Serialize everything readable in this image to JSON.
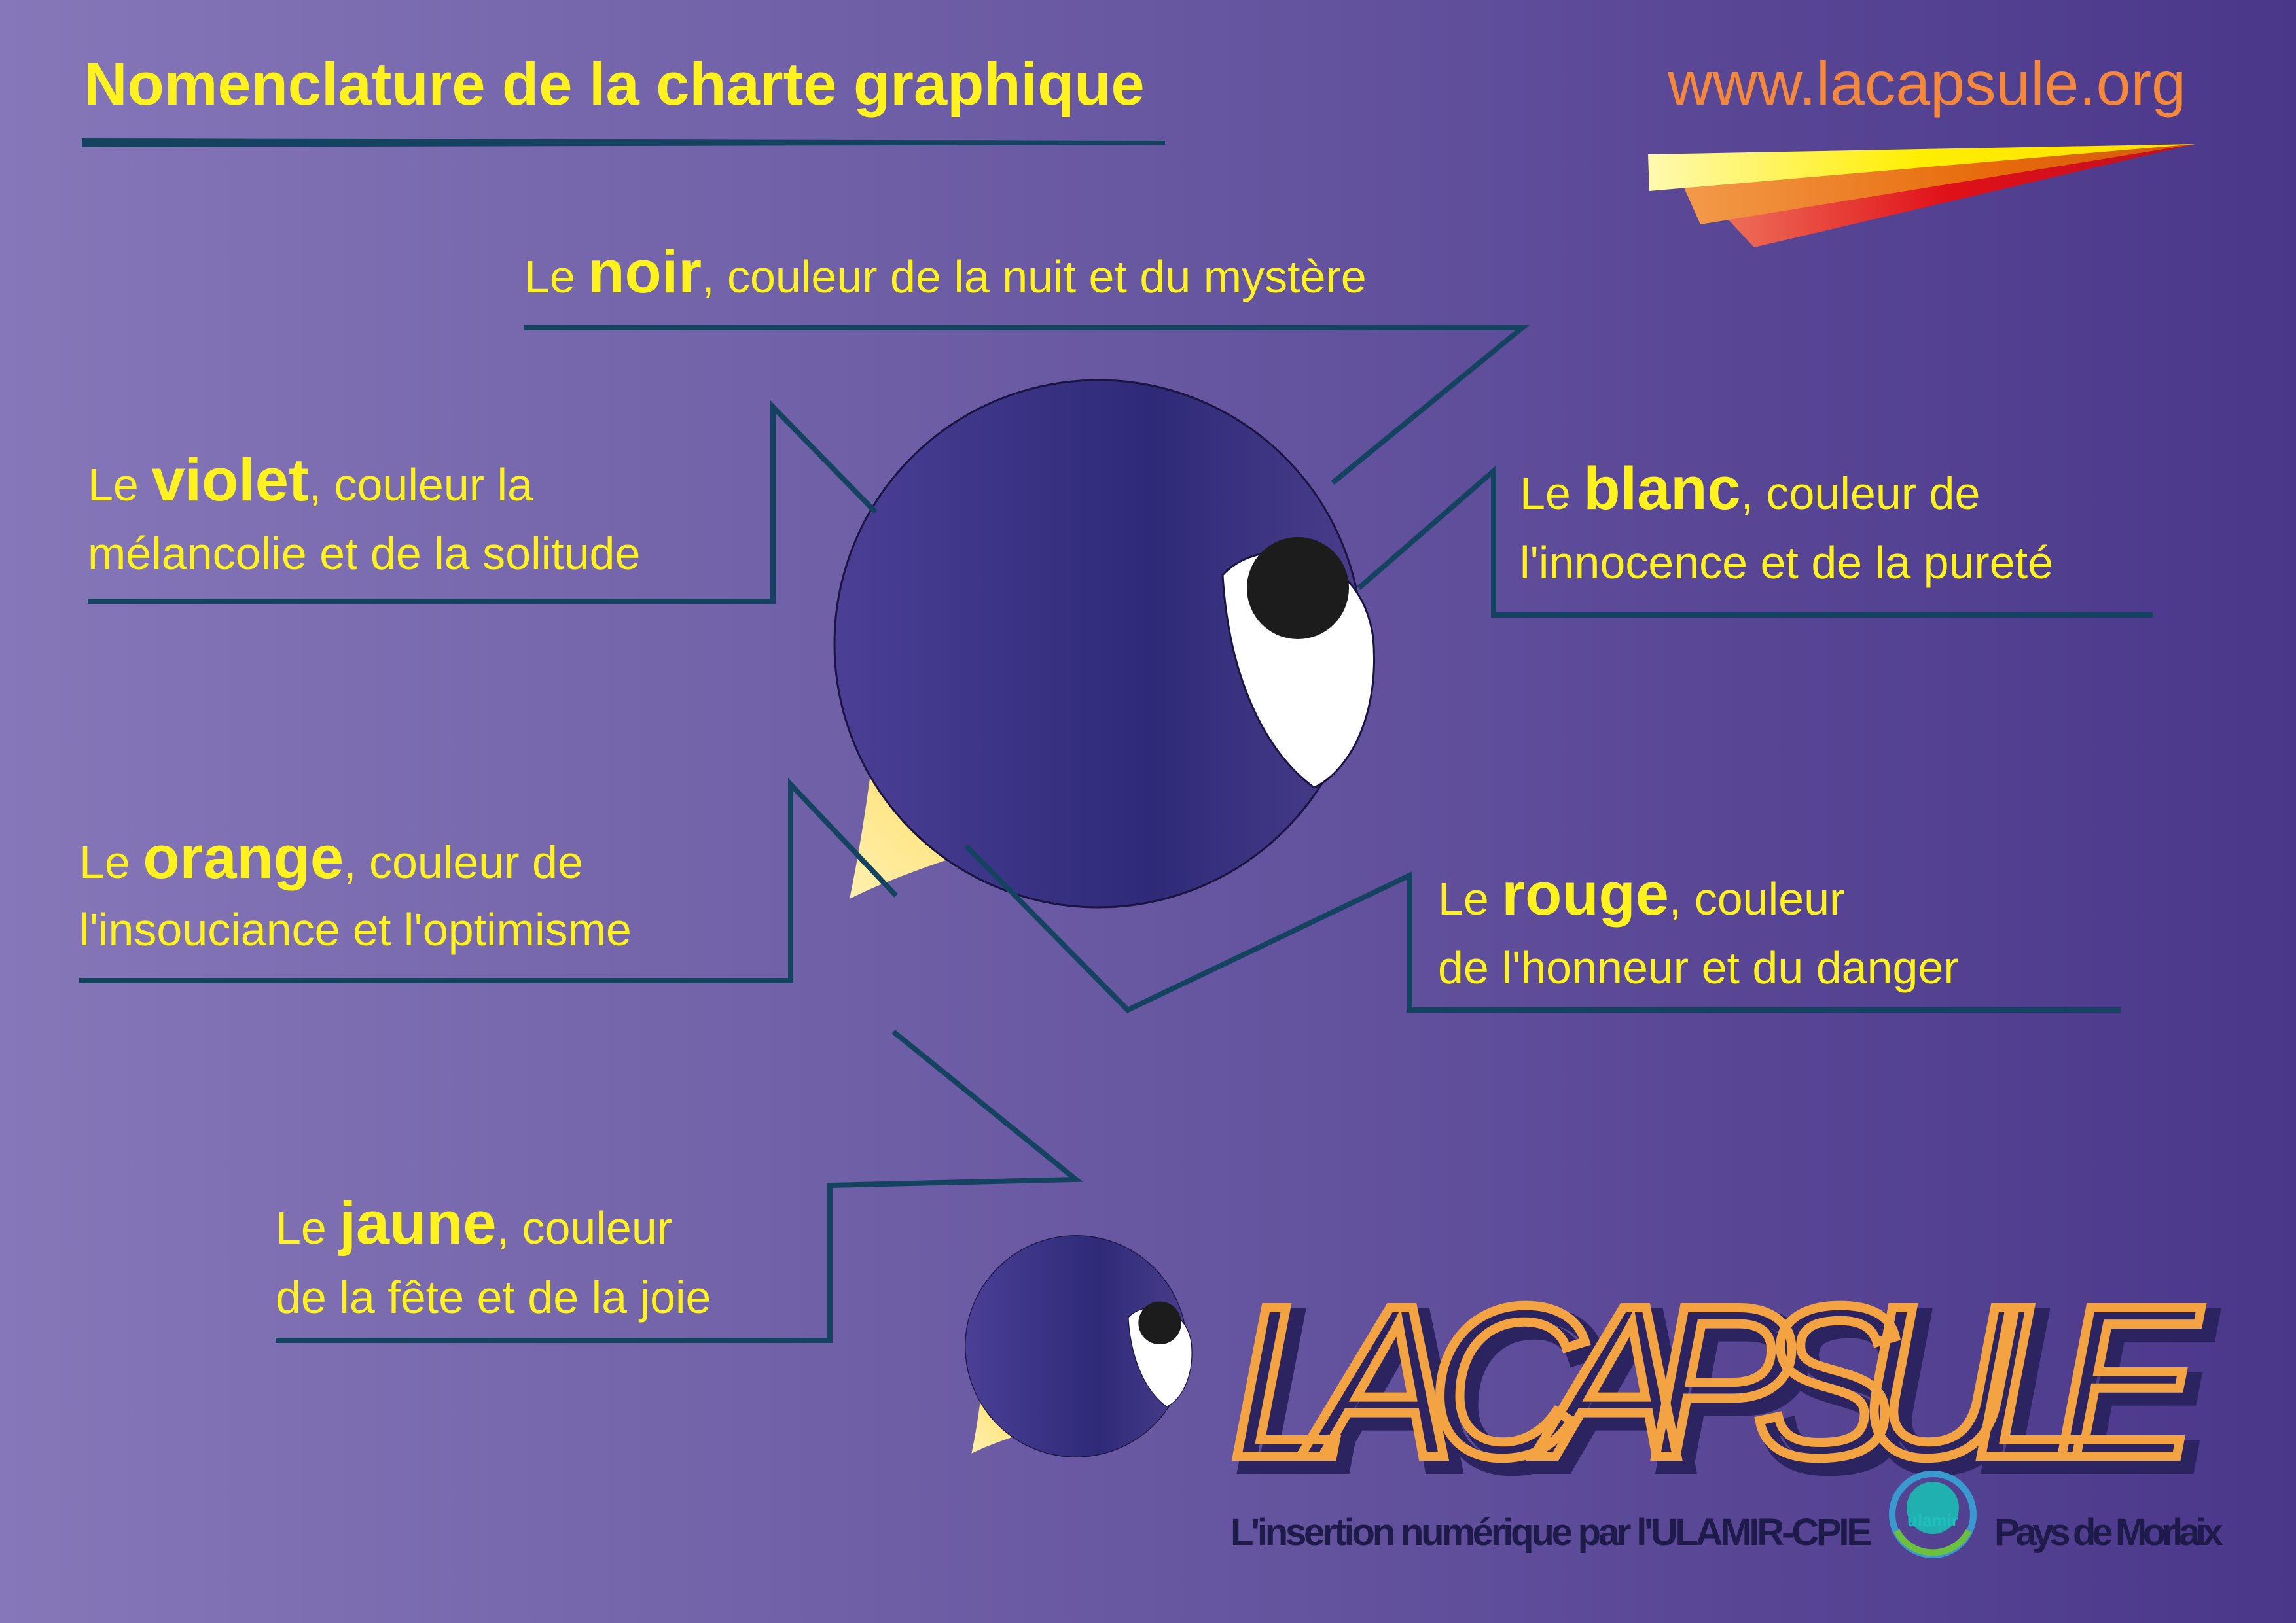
{
  "header": {
    "title": "Nomenclature de la charte graphique",
    "url": "www.lacapsule.org"
  },
  "colors": {
    "background_left": "#8577b8",
    "background_right": "#4a378a",
    "text": "#fff21e",
    "url": "#f5883b",
    "violet": "#3b3380",
    "line": "#13435f"
  },
  "labels": {
    "noir": {
      "pre": "Le ",
      "color": "noir",
      "post": ", couleur de la nuit et du mystère"
    },
    "violet": {
      "pre": "Le ",
      "color": "violet",
      "post": ", couleur la",
      "line2": "mélancolie et de la solitude"
    },
    "blanc": {
      "pre": "Le ",
      "color": "blanc",
      "post": ", couleur de",
      "line2": "l'innocence et de la pureté"
    },
    "orange": {
      "pre": "Le ",
      "color": "orange",
      "post": ", couleur de",
      "line2": "l'insouciance et l'optimisme"
    },
    "rouge": {
      "pre": "Le ",
      "color": "rouge",
      "post": ", couleur",
      "line2": "de l'honneur et du danger"
    },
    "jaune": {
      "pre": "Le ",
      "color": "jaune",
      "post": ", couleur",
      "line2": "de la fête et de la joie"
    }
  },
  "logo": {
    "name": "LA CAPSULE",
    "tagline": "L'insertion numérique par l'ULAMIR-CPIE",
    "region": "Pays de Morlaix",
    "partner": "ulamir"
  }
}
